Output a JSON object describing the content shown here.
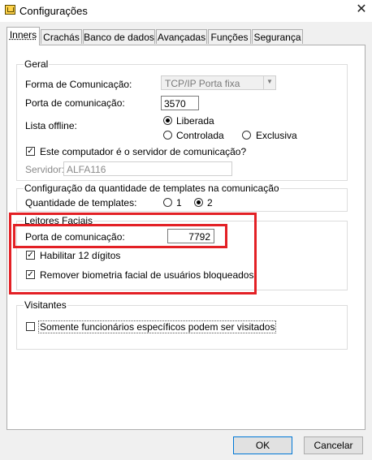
{
  "window": {
    "title": "Configurações",
    "close_glyph": "✕"
  },
  "tabs": [
    {
      "label": "Inners",
      "active": true
    },
    {
      "label": "Crachás"
    },
    {
      "label": "Banco de dados"
    },
    {
      "label": "Avançadas"
    },
    {
      "label": "Funções"
    },
    {
      "label": "Segurança"
    }
  ],
  "geral": {
    "title": "Geral",
    "forma_label": "Forma de Comunicação:",
    "forma_value": "TCP/IP Porta fixa",
    "porta_label": "Porta de comunicação:",
    "porta_value": "3570",
    "lista_label": "Lista offline:",
    "lista_options": [
      "Liberada",
      "Controlada",
      "Exclusiva"
    ],
    "lista_selected": "Liberada",
    "servidor_check_label": "Este computador é o servidor de comunicação?",
    "servidor_check_checked": true,
    "servidor_label": "Servidor:",
    "servidor_value": "ALFA116"
  },
  "templates": {
    "title": "Configuração da quantidade de templates na comunicação",
    "qtd_label": "Quantidade de templates:",
    "options": [
      "1",
      "2"
    ],
    "selected": "2"
  },
  "leitores": {
    "title": "Leitores Faciais",
    "porta_label": "Porta de comunicação:",
    "porta_value": "7792",
    "habilitar_label": "Habilitar 12 dígitos",
    "habilitar_checked": true,
    "remover_label": "Remover biometria facial de usuários bloqueados",
    "remover_checked": true,
    "highlight_color": "#e32025"
  },
  "visitantes": {
    "title": "Visitantes",
    "somente_label": "Somente funcionários específicos podem ser visitados",
    "somente_checked": false
  },
  "buttons": {
    "ok": "OK",
    "cancel": "Cancelar"
  }
}
